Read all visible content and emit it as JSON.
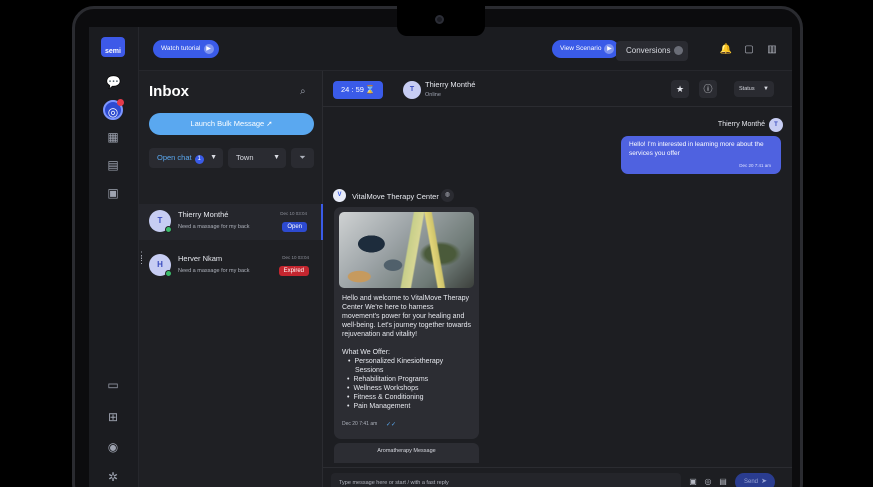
{
  "brand": {
    "logo_text": "semi"
  },
  "topbar": {
    "watch_tutorial": "Watch tutorial",
    "view_scenario": "View Scenario",
    "conversions": "Conversions"
  },
  "rail": {
    "icons": [
      "chat-bubble-icon",
      "inbox-icon",
      "calendar-icon",
      "store-icon",
      "contacts-icon",
      "grid-add-icon",
      "circle-icon",
      "settings-icon"
    ]
  },
  "inbox": {
    "title": "Inbox",
    "bulk_button": "Launch Bulk Message",
    "filter_open_chat": "Open chat",
    "open_chat_count": "1",
    "filter_town": "Town",
    "chats": [
      {
        "initial": "T",
        "name": "Thierry Monthé",
        "message": "Need a massage for my back",
        "date": "Dec 10 03:04",
        "status": "Open"
      },
      {
        "initial": "H",
        "name": "Herver Nkam",
        "message": "Need a massage for my back",
        "date": "Dec 10 03:04",
        "status": "Expired"
      }
    ]
  },
  "conversation": {
    "timer": "24 : 59",
    "contact_initial": "T",
    "contact_name": "Thierry Monthé",
    "contact_status": "Online",
    "status_dropdown": "Status",
    "outgoing": {
      "sender": "Thierry Monthé",
      "sender_initial": "T",
      "text": "Hello! I'm interested in learning more about the services you offer",
      "time": "Dec 20 7:41 am"
    },
    "business": {
      "initial": "V",
      "name": "VitalMove Therapy Center"
    },
    "incoming": {
      "intro": "Hello and welcome to VitalMove Therapy Center We're here to harness movement's power for your healing and well-being. Let's journey together towards rejuvenation and vitality!",
      "offer_heading": "What We Offer:",
      "offers": [
        "Personalized Kinesiotherapy Sessions",
        "Rehabilitation Programs",
        "Wellness Workshops",
        "Fitness & Conditioning",
        "Pain Management"
      ],
      "time": "Dec 20 7:41 am"
    },
    "next_card": "Aromatherapy Message",
    "input_placeholder": "Type message here or start / with a fast reply",
    "send_label": "Send"
  },
  "colors": {
    "accent": "#3a5be8",
    "bubble_out": "#4f62e0",
    "open_tag": "#2d4ad0",
    "expired_tag": "#c4262f",
    "bulk_button": "#5aa8f0"
  }
}
